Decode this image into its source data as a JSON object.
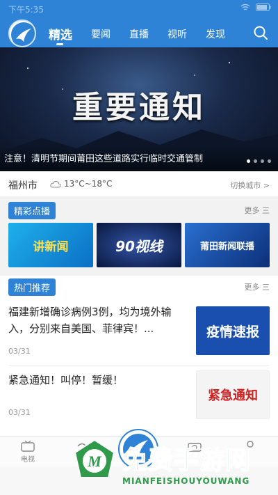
{
  "status_bar": {
    "time": "下午5:35"
  },
  "nav": {
    "tabs": [
      {
        "label": "精选",
        "active": true
      },
      {
        "label": "要闻"
      },
      {
        "label": "直播"
      },
      {
        "label": "视听"
      },
      {
        "label": "发现"
      }
    ],
    "search_icon": "search-icon"
  },
  "banner": {
    "title": "重要通知",
    "caption": "注意！清明节期间莆田这些道路实行临时交通管制",
    "dot_count": 4,
    "active_dot": 0
  },
  "weather": {
    "city": "福州市",
    "temperature": "13°C~18°C",
    "icon": "cloud-icon",
    "switch_label": "切换城市 >"
  },
  "section_highlights": {
    "label": "精彩点播",
    "more": "更多 三"
  },
  "video_cards": [
    {
      "title": "讲新闻",
      "color": "#1a9de0"
    },
    {
      "title": "90视线",
      "color": "#0d2a6a"
    },
    {
      "title": "莆田新闻联播",
      "color": "#1650a8"
    }
  ],
  "section_hot": {
    "label": "热门推荐",
    "more": "更多 三"
  },
  "news": [
    {
      "title": "福建新增确诊病例3例，均为境外输入，分别来自美国、菲律宾！...",
      "date": "03/31",
      "thumb_text": "疫情速报",
      "thumb_color": "#1a4fb0"
    },
    {
      "title": "紧急通知！叫停！暂缓！",
      "date": "03/31",
      "thumb_text": "紧急通知",
      "thumb_color": "#d02020"
    }
  ],
  "bottom_tabs": [
    {
      "label": "电视",
      "icon": "tv-icon"
    },
    {
      "label": "",
      "icon": "radio-icon"
    },
    {
      "label": "",
      "icon": "home-logo-icon"
    },
    {
      "label": "",
      "icon": "camera-icon"
    },
    {
      "label": "",
      "icon": "user-icon"
    }
  ],
  "watermark": {
    "title": "免费手游网",
    "subtitle": "MIANFEISHOUYOUWANG"
  },
  "colors": {
    "brand": "#2e83d7",
    "watermark": "#2f9a4a"
  }
}
